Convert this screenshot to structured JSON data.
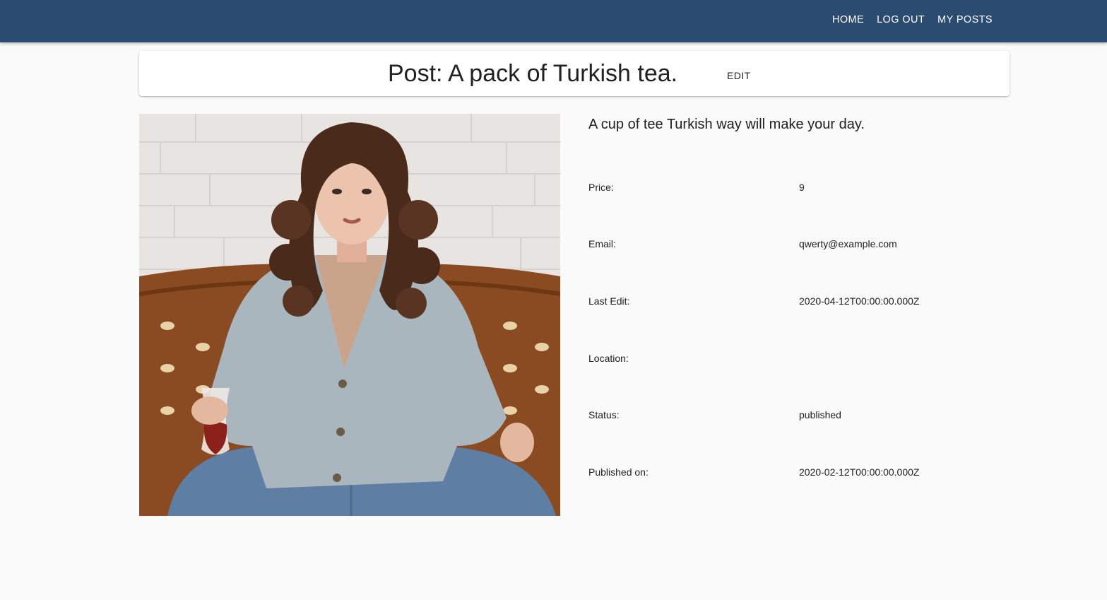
{
  "nav": {
    "home": "HOME",
    "logout": "LOG OUT",
    "my_posts": "MY POSTS"
  },
  "post": {
    "title": "Post: A pack of Turkish tea.",
    "edit_label": "EDIT",
    "description": "A cup of tee Turkish way will make your day.",
    "fields": [
      {
        "label": "Price:",
        "value": "9"
      },
      {
        "label": "Email:",
        "value": "qwerty@example.com"
      },
      {
        "label": "Last Edit:",
        "value": "2020-04-12T00:00:00.000Z"
      },
      {
        "label": "Location:",
        "value": ""
      },
      {
        "label": "Status:",
        "value": "published"
      },
      {
        "label": "Published on:",
        "value": "2020-02-12T00:00:00.000Z"
      }
    ]
  },
  "colors": {
    "appbar": "#2b4c70",
    "background": "#fafafa"
  }
}
